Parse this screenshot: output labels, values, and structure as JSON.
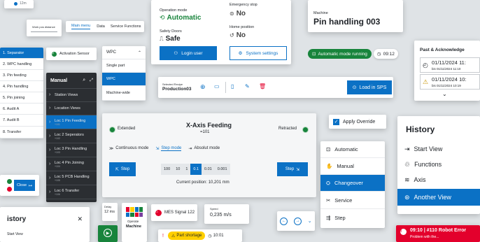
{
  "top_left_fragment": "12m",
  "workpiece_card": {
    "title": "Work pos distance"
  },
  "tabs": [
    "Main menu",
    "Data",
    "Service Functions"
  ],
  "left_steps": [
    "1. Separator",
    "2. WPC handling",
    "3. Pin feeding",
    "4. Pin handling",
    "5. Pin joining",
    "6. Audit A",
    "7. Audit B",
    "8. Transfer"
  ],
  "activation": {
    "label": "Activation Sensor"
  },
  "close_button": {
    "label": "Close"
  },
  "manual_nav": {
    "title": "Manual",
    "items": [
      {
        "label": "Station Views",
        "sub": ""
      },
      {
        "label": "Location Views",
        "sub": ""
      },
      {
        "label": "Loc 1 Pin Feeding",
        "sub": "+101"
      },
      {
        "label": "Loc 2 Seperators",
        "sub": "+102"
      },
      {
        "label": "Loc 3 Pin Handling",
        "sub": "+103"
      },
      {
        "label": "Loc 4 Pin Joining",
        "sub": "+104"
      },
      {
        "label": "Loc 5 PCB Handling",
        "sub": "+105"
      },
      {
        "label": "Loc 6 Transfer",
        "sub": "+106"
      }
    ]
  },
  "wpc_menu": {
    "title": "WPC",
    "items": [
      "Single part",
      "WPC",
      "Machine-wide"
    ]
  },
  "status": {
    "op_mode_label": "Operation mode",
    "op_mode_value": "Automatic",
    "emergency_label": "Emergency stop",
    "emergency_value": "No",
    "doors_label": "Safety Doors",
    "doors_value": "Safe",
    "home_label": "Home position",
    "home_value": "No",
    "login_button": "Login user",
    "settings_button": "System settings"
  },
  "machine": {
    "label": "Machine",
    "name": "Pin handling 003"
  },
  "auto_running": {
    "label": "Automatic mode running",
    "time": "09:12"
  },
  "recipe": {
    "label": "Selected Recipe",
    "value": "Production03",
    "load_button": "Load in SPS"
  },
  "axis": {
    "extended": "Extended",
    "title": "X-Axis Feeding",
    "subtitle": "=101",
    "retracted": "Retracted",
    "modes": [
      "Continuous mode",
      "Step mode",
      "Absolut mode"
    ],
    "step_left": "Step",
    "step_right": "Step",
    "steps": [
      "100",
      "10",
      "1",
      "0.1",
      "0.01",
      "0.001"
    ],
    "position": "Current position: 10,201 mm"
  },
  "apply_override": {
    "label": "Apply Override"
  },
  "mode_menu": {
    "items": [
      "Automatic",
      "Manual",
      "Changeover",
      "Service",
      "Step"
    ]
  },
  "past": {
    "title": "Past & Acknowledge",
    "entries": [
      {
        "date": "01/11/2024 11:",
        "until": "bis 01/11/2024 11:10"
      },
      {
        "date": "01/11/2024 10:",
        "until": "bis 01/11/2024 10:19"
      }
    ]
  },
  "history": {
    "title": "History",
    "items": [
      "Start View",
      "Functions",
      "Axis",
      "Another View"
    ]
  },
  "bottom_history": {
    "title": "istory",
    "item": "Start View"
  },
  "delay": {
    "label": "Delay",
    "value": "12 ms"
  },
  "operate": {
    "line1": "Operate",
    "line2": "Machine"
  },
  "mes": {
    "label": "MES Signal 122"
  },
  "speed": {
    "label": "Speed",
    "value": "0,235 m/s"
  },
  "part_shortage": {
    "label": "Part shortage",
    "time": "10:01"
  },
  "robot_error": {
    "label": "09:10 | #110 Robot Error",
    "sub": "Problem with the..."
  },
  "colors": {
    "blue": "#0b71c5",
    "green": "#18843c",
    "red": "#e3002c",
    "yellow": "#ffcf00"
  }
}
